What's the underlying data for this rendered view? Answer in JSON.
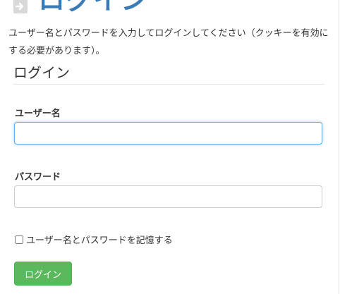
{
  "header": {
    "title": "ログイン",
    "icon": "login-icon"
  },
  "intro": {
    "text": "ユーザー名とパスワードを入力してログインしてください（クッキーを有効にする必要があります）。"
  },
  "form": {
    "legend": "ログイン",
    "username_label": "ユーザー名",
    "username_value": "",
    "password_label": "パスワード",
    "password_value": "",
    "remember_label": "ユーザー名とパスワードを記憶する",
    "remember_checked": false,
    "submit_label": "ログイン"
  },
  "colors": {
    "heading": "#3a7bb5",
    "button": "#5cb85c",
    "focus": "#66afe9"
  }
}
